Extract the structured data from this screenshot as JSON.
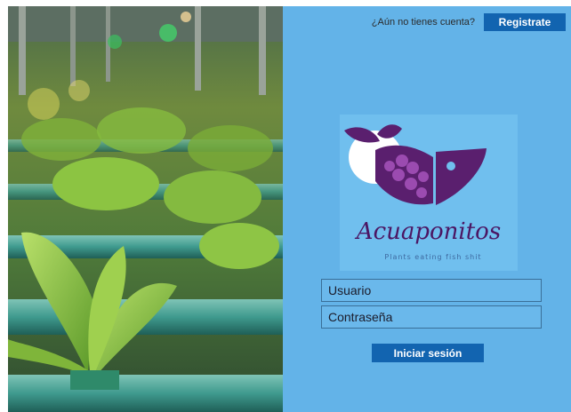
{
  "header": {
    "prompt_text": "¿Aún no tienes cuenta?",
    "signup_label": "Registrate"
  },
  "logo": {
    "brand_name": "Acuaponitos",
    "tagline": "Plants eating fish shit"
  },
  "form": {
    "username_placeholder": "Usuario",
    "password_placeholder": "Contraseña",
    "login_label": "Iniciar sesión"
  },
  "colors": {
    "panel_bg": "#63b3e8",
    "button_bg": "#1264b0",
    "logo_purple": "#5a1f6e"
  }
}
